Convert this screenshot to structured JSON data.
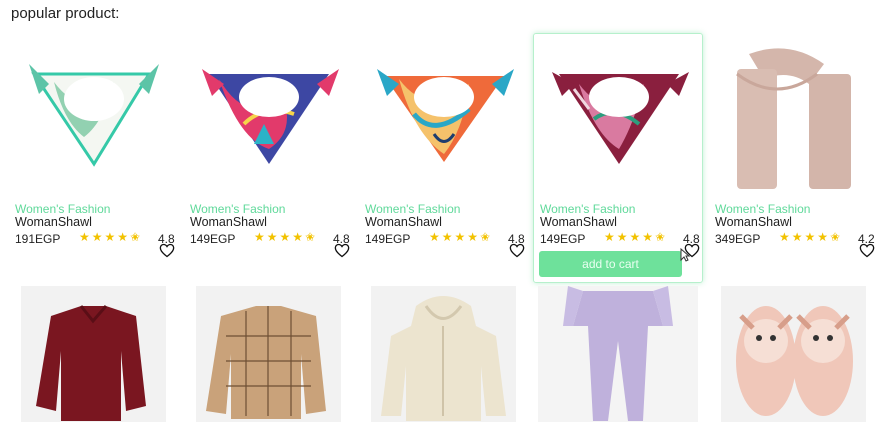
{
  "section": {
    "title": "popular product:"
  },
  "products": [
    {
      "category": "Women's Fashion",
      "name": "WomanShawl",
      "price": "191EGP",
      "rating": "4.8",
      "stars": "★★★★✬"
    },
    {
      "category": "Women's Fashion",
      "name": "WomanShawl",
      "price": "149EGP",
      "rating": "4.8",
      "stars": "★★★★✬"
    },
    {
      "category": "Women's Fashion",
      "name": "WomanShawl",
      "price": "149EGP",
      "rating": "4.8",
      "stars": "★★★★✬"
    },
    {
      "category": "Women's Fashion",
      "name": "WomanShawl",
      "price": "149EGP",
      "rating": "4.8",
      "stars": "★★★★✬",
      "add_to_cart": "add to cart"
    },
    {
      "category": "Women's Fashion",
      "name": "WomanShawl",
      "price": "349EGP",
      "rating": "4.2",
      "stars": "★★★★✬"
    }
  ],
  "colors": {
    "accent": "#5fd99a",
    "button": "#6ee19b",
    "star": "#f2c200"
  }
}
